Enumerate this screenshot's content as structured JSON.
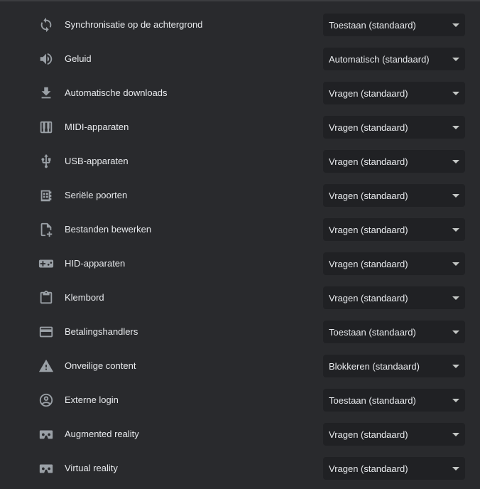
{
  "colors": {
    "background": "#292a2d",
    "text": "#e8eaed",
    "icon": "#9aa0a6",
    "select_background": "#202124"
  },
  "settings": [
    {
      "icon": "sync-icon",
      "label": "Synchronisatie op de achtergrond",
      "value": "Toestaan (standaard)"
    },
    {
      "icon": "speaker-icon",
      "label": "Geluid",
      "value": "Automatisch (standaard)"
    },
    {
      "icon": "download-icon",
      "label": "Automatische downloads",
      "value": "Vragen (standaard)"
    },
    {
      "icon": "piano-icon",
      "label": "MIDI-apparaten",
      "value": "Vragen (standaard)"
    },
    {
      "icon": "usb-icon",
      "label": "USB-apparaten",
      "value": "Vragen (standaard)"
    },
    {
      "icon": "serial-port-icon",
      "label": "Seriële poorten",
      "value": "Vragen (standaard)"
    },
    {
      "icon": "file-edit-icon",
      "label": "Bestanden bewerken",
      "value": "Vragen (standaard)"
    },
    {
      "icon": "gamepad-icon",
      "label": "HID-apparaten",
      "value": "Vragen (standaard)"
    },
    {
      "icon": "clipboard-icon",
      "label": "Klembord",
      "value": "Vragen (standaard)"
    },
    {
      "icon": "credit-card-icon",
      "label": "Betalingshandlers",
      "value": "Toestaan (standaard)"
    },
    {
      "icon": "warning-icon",
      "label": "Onveilige content",
      "value": "Blokkeren (standaard)"
    },
    {
      "icon": "account-circle-icon",
      "label": "Externe login",
      "value": "Toestaan (standaard)"
    },
    {
      "icon": "vr-headset-icon",
      "label": "Augmented reality",
      "value": "Vragen (standaard)"
    },
    {
      "icon": "vr-headset-icon",
      "label": "Virtual reality",
      "value": "Vragen (standaard)"
    }
  ]
}
